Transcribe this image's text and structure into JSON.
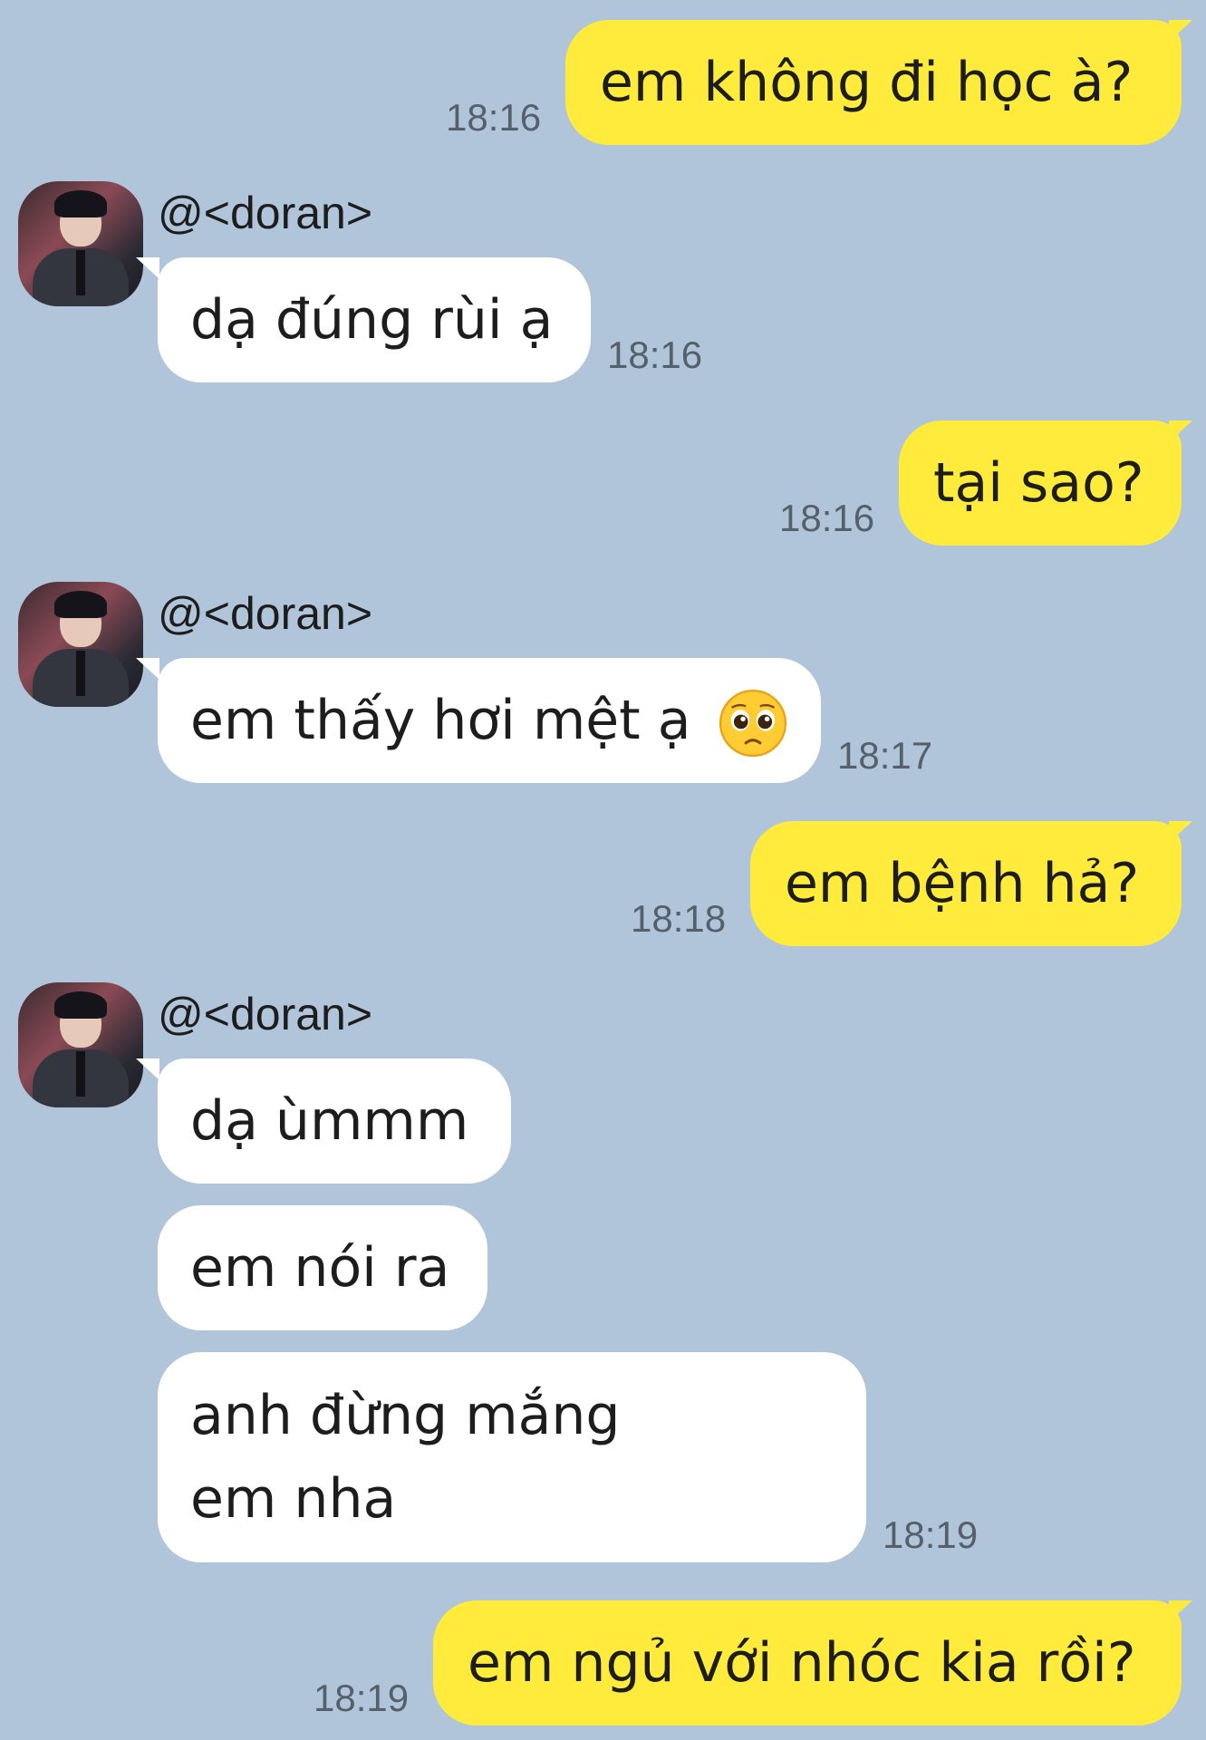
{
  "messages": [
    {
      "id": "m1",
      "side": "out",
      "text": "em không đi học à?",
      "time": "18:16"
    },
    {
      "id": "m2",
      "side": "in",
      "sender": "@<doran>",
      "text": "dạ đúng rùi ạ",
      "time": "18:16"
    },
    {
      "id": "m3",
      "side": "out",
      "text": "tại sao?",
      "time": "18:16"
    },
    {
      "id": "m4",
      "side": "in",
      "sender": "@<doran>",
      "text": "em thấy hơi mệt ạ",
      "emoji": "pleading-face-emoji",
      "time": "18:17"
    },
    {
      "id": "m5",
      "side": "out",
      "text": "em bệnh hả?",
      "time": "18:18"
    },
    {
      "id": "m6",
      "side": "in",
      "sender": "@<doran>",
      "text": "dạ ùmmm"
    },
    {
      "id": "m7",
      "side": "in",
      "text": "em nói ra"
    },
    {
      "id": "m8",
      "side": "in",
      "text": "anh đừng mắng em nha",
      "time": "18:19"
    },
    {
      "id": "m9",
      "side": "out",
      "text": "em ngủ với nhóc kia rồi?",
      "time": "18:19"
    }
  ],
  "colors": {
    "background": "#b1c5da",
    "outgoing_bubble": "#ffeb3b",
    "incoming_bubble": "#ffffff"
  }
}
